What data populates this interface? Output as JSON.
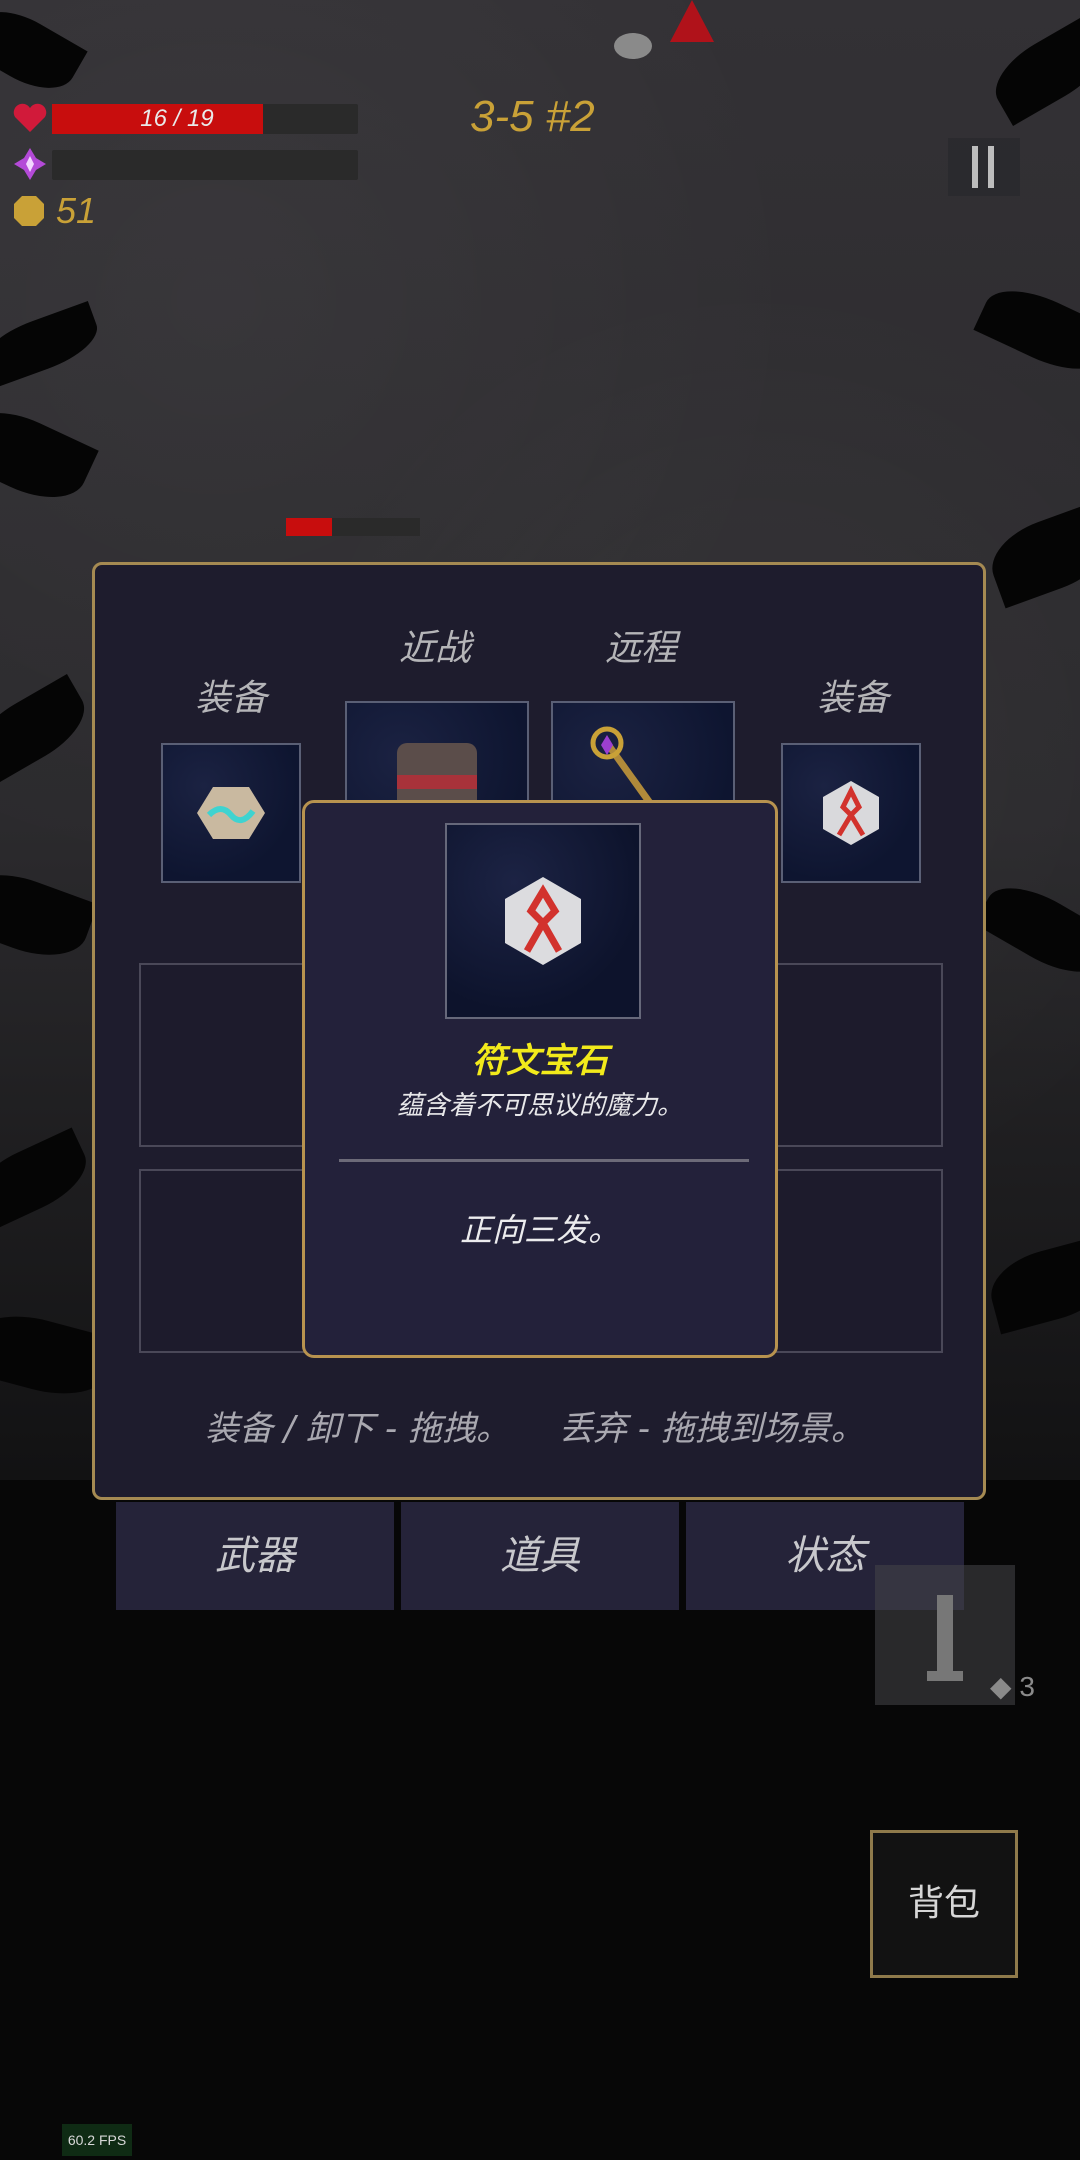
{
  "hud": {
    "hp_text": "16 / 19",
    "hp": {
      "current": 16,
      "max": 19
    },
    "mana_fraction": 0,
    "coins": "51",
    "level": "3-5 #2"
  },
  "enemy": {
    "hp_fraction": 0.34
  },
  "inventory": {
    "labels": {
      "equip_left": "装备",
      "melee": "近战",
      "ranged": "远程",
      "equip_right": "装备"
    },
    "slots": [
      {
        "slot": "equip_left",
        "item": "cyan-rune-gem"
      },
      {
        "slot": "melee",
        "item": "gauntlet"
      },
      {
        "slot": "ranged",
        "item": "magic-staff"
      },
      {
        "slot": "equip_right",
        "item": "red-rune-gem"
      }
    ],
    "hint_equip": "装备 / 卸下 - 拖拽。",
    "hint_drop": "丢弃 - 拖拽到场景。"
  },
  "tooltip": {
    "item_name": "符文宝石",
    "item_description": "蕴含着不可思议的魔力。",
    "item_effect": "正向三发。",
    "icon": "red-rune-gem"
  },
  "tabs": [
    "武器",
    "道具",
    "状态"
  ],
  "ghost_item_count": "3",
  "bag_label": "背包",
  "fps": "60.2 FPS",
  "colors": {
    "gold": "#c9a137",
    "hp_red": "#c80d0d",
    "item_name_yellow": "#f2ea1b",
    "panel_bg": "#1e1c2d",
    "panel_border": "#a58a52"
  }
}
